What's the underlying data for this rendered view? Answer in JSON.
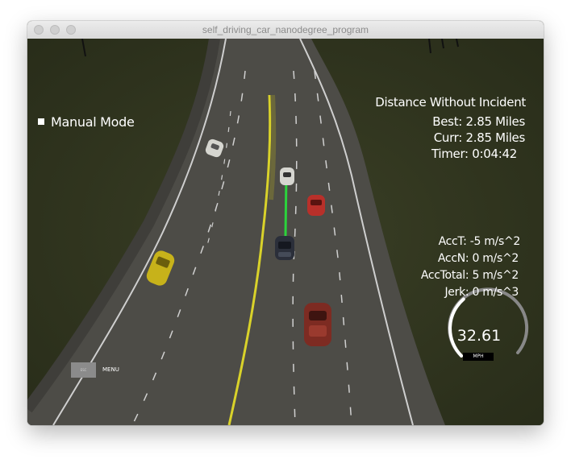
{
  "window": {
    "title": "self_driving_car_nanodegree_program"
  },
  "hud": {
    "mode_label": "Manual Mode",
    "distance_title": "Distance Without Incident",
    "best": "Best: 2.85 Miles",
    "curr": "Curr: 2.85 Miles",
    "timer": "Timer: 0:04:42",
    "acc_t": "AccT: -5 m/s^2",
    "acc_n": "AccN: 0 m/s^2",
    "acc_total": "AccTotal: 5 m/s^2",
    "jerk": "Jerk: 0 m/s^3"
  },
  "speedometer": {
    "value": "32.61",
    "unit": "MPH",
    "fill_fraction": 0.35
  },
  "menu": {
    "esc_label": "ESC",
    "menu_label": "MENU"
  },
  "colors": {
    "grass": "#2e321f",
    "road": "#4e4d47",
    "lane_yellow": "#d9d22a",
    "path_green": "#2bd33c",
    "ego_car": "#2b2f3a",
    "red_car": "#b8302a",
    "maroon_car": "#7d2b22",
    "yellow_car": "#c7b21a",
    "white_car": "#d6d6d0"
  }
}
